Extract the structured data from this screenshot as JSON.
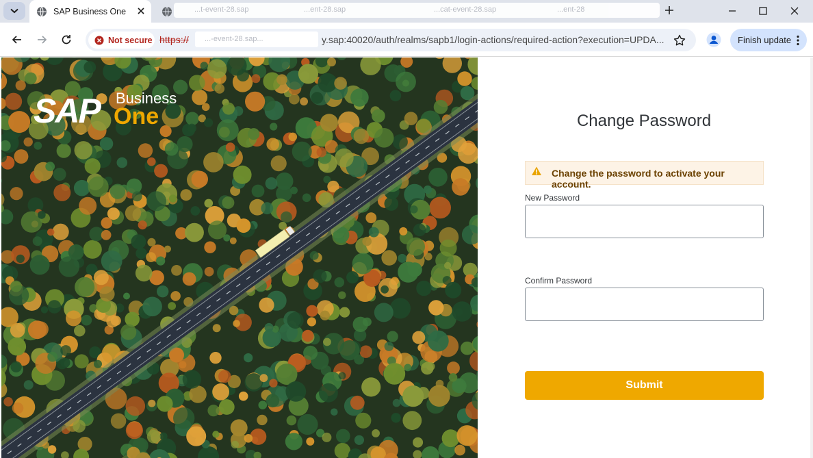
{
  "browser": {
    "active_tab": {
      "title": "SAP Business One",
      "favicon": "globe-icon"
    },
    "inactive_tab": {
      "favicon": "globe-icon",
      "redacted_fragments": [
        "...t-event-28.sap",
        "...ent-28.sap",
        "...cat-event-28.sap",
        "...ent-28"
      ]
    },
    "window_controls": {
      "minimize": "minimize-icon",
      "maximize": "maximize-icon",
      "close": "close-icon"
    },
    "nav": {
      "back": "back-arrow-icon",
      "forward": "forward-arrow-icon",
      "reload": "reload-icon"
    },
    "security": {
      "label": "Not secure",
      "icon": "error-circle-icon",
      "color": "#b3261e"
    },
    "url": {
      "scheme": "https://",
      "redacted_fragment": "...-event-28.sap...",
      "tail": "y.sap:40020/auth/realms/sapb1/login-actions/required-action?execution=UPDA..."
    },
    "finish_update_label": "Finish update"
  },
  "brand": {
    "word_sap": "SAP",
    "word_business": "Business",
    "word_one": "One",
    "accent": "#efa800"
  },
  "form": {
    "title": "Change Password",
    "alert": {
      "text": "Change the password to activate your account.",
      "icon": "warning-triangle-icon"
    },
    "new_password": {
      "label": "New Password",
      "value": "",
      "placeholder": ""
    },
    "confirm_password": {
      "label": "Confirm Password",
      "value": "",
      "placeholder": ""
    },
    "submit_label": "Submit",
    "button_color": "#efa800"
  }
}
